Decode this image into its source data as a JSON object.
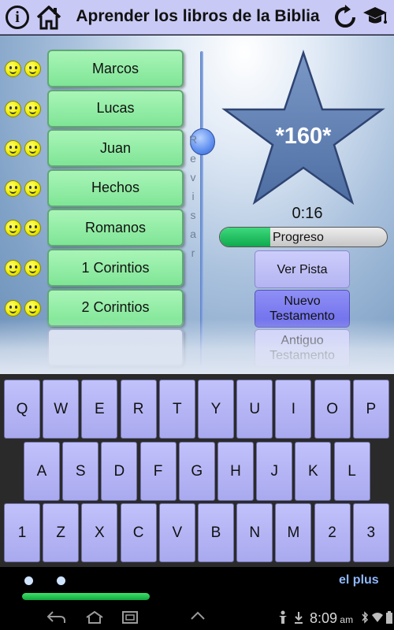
{
  "header": {
    "title": "Aprender los libros de la Biblia",
    "icons": [
      "info-icon",
      "home-icon",
      "refresh-icon",
      "graduation-cap-icon"
    ]
  },
  "books": [
    {
      "label": "Marcos",
      "smileys": 2
    },
    {
      "label": "Lucas",
      "smileys": 2
    },
    {
      "label": "Juan",
      "smileys": 2
    },
    {
      "label": "Hechos",
      "smileys": 2
    },
    {
      "label": "Romanos",
      "smileys": 2
    },
    {
      "label": "1 Corintios",
      "smileys": 2
    },
    {
      "label": "2 Corintios",
      "smileys": 2
    },
    {
      "label": "",
      "smileys": 0
    }
  ],
  "review_slider": {
    "label_letters": [
      "R",
      "e",
      "v",
      "i",
      "s",
      "a",
      "r"
    ],
    "level": 0.28
  },
  "score": "*160*",
  "timer": "0:16",
  "progress": {
    "label": "Progreso",
    "fraction": 0.3
  },
  "options": [
    {
      "label": "Ver Pista",
      "active": false
    },
    {
      "label": "Nuevo Testamento",
      "active": true
    },
    {
      "label": "Antiguo Testamento",
      "active": false
    }
  ],
  "keyboard": {
    "rows": [
      [
        "Q",
        "W",
        "E",
        "R",
        "T",
        "Y",
        "U",
        "I",
        "O",
        "P"
      ],
      [
        "A",
        "S",
        "D",
        "F",
        "G",
        "H",
        "J",
        "K",
        "L"
      ],
      [
        "1",
        "Z",
        "X",
        "C",
        "V",
        "B",
        "N",
        "M",
        "2",
        "3"
      ]
    ]
  },
  "footer": {
    "brand": "el plus",
    "page_dots": 2
  },
  "status_bar": {
    "time": "8:09",
    "am_pm": "am"
  },
  "colors": {
    "book_green": "#8cec9f",
    "button_lavender": "#c1c1f8",
    "button_active": "#7d7df0",
    "star_blue": "#5d7fb0",
    "progress_green": "#1fc95f"
  }
}
